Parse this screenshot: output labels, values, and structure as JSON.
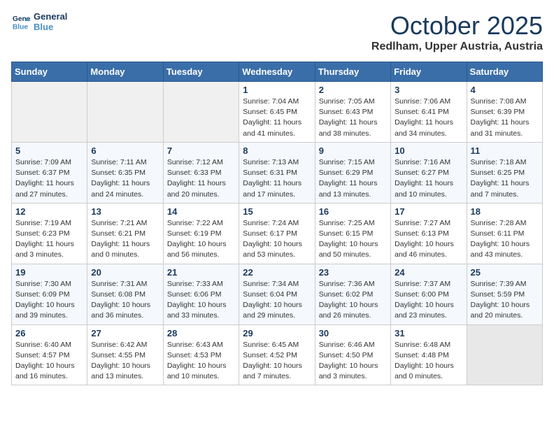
{
  "header": {
    "logo_line1": "General",
    "logo_line2": "Blue",
    "month": "October 2025",
    "location": "Redlham, Upper Austria, Austria"
  },
  "weekdays": [
    "Sunday",
    "Monday",
    "Tuesday",
    "Wednesday",
    "Thursday",
    "Friday",
    "Saturday"
  ],
  "weeks": [
    [
      {
        "day": "",
        "sunrise": "",
        "sunset": "",
        "daylight": ""
      },
      {
        "day": "",
        "sunrise": "",
        "sunset": "",
        "daylight": ""
      },
      {
        "day": "",
        "sunrise": "",
        "sunset": "",
        "daylight": ""
      },
      {
        "day": "1",
        "sunrise": "Sunrise: 7:04 AM",
        "sunset": "Sunset: 6:45 PM",
        "daylight": "Daylight: 11 hours and 41 minutes."
      },
      {
        "day": "2",
        "sunrise": "Sunrise: 7:05 AM",
        "sunset": "Sunset: 6:43 PM",
        "daylight": "Daylight: 11 hours and 38 minutes."
      },
      {
        "day": "3",
        "sunrise": "Sunrise: 7:06 AM",
        "sunset": "Sunset: 6:41 PM",
        "daylight": "Daylight: 11 hours and 34 minutes."
      },
      {
        "day": "4",
        "sunrise": "Sunrise: 7:08 AM",
        "sunset": "Sunset: 6:39 PM",
        "daylight": "Daylight: 11 hours and 31 minutes."
      }
    ],
    [
      {
        "day": "5",
        "sunrise": "Sunrise: 7:09 AM",
        "sunset": "Sunset: 6:37 PM",
        "daylight": "Daylight: 11 hours and 27 minutes."
      },
      {
        "day": "6",
        "sunrise": "Sunrise: 7:11 AM",
        "sunset": "Sunset: 6:35 PM",
        "daylight": "Daylight: 11 hours and 24 minutes."
      },
      {
        "day": "7",
        "sunrise": "Sunrise: 7:12 AM",
        "sunset": "Sunset: 6:33 PM",
        "daylight": "Daylight: 11 hours and 20 minutes."
      },
      {
        "day": "8",
        "sunrise": "Sunrise: 7:13 AM",
        "sunset": "Sunset: 6:31 PM",
        "daylight": "Daylight: 11 hours and 17 minutes."
      },
      {
        "day": "9",
        "sunrise": "Sunrise: 7:15 AM",
        "sunset": "Sunset: 6:29 PM",
        "daylight": "Daylight: 11 hours and 13 minutes."
      },
      {
        "day": "10",
        "sunrise": "Sunrise: 7:16 AM",
        "sunset": "Sunset: 6:27 PM",
        "daylight": "Daylight: 11 hours and 10 minutes."
      },
      {
        "day": "11",
        "sunrise": "Sunrise: 7:18 AM",
        "sunset": "Sunset: 6:25 PM",
        "daylight": "Daylight: 11 hours and 7 minutes."
      }
    ],
    [
      {
        "day": "12",
        "sunrise": "Sunrise: 7:19 AM",
        "sunset": "Sunset: 6:23 PM",
        "daylight": "Daylight: 11 hours and 3 minutes."
      },
      {
        "day": "13",
        "sunrise": "Sunrise: 7:21 AM",
        "sunset": "Sunset: 6:21 PM",
        "daylight": "Daylight: 11 hours and 0 minutes."
      },
      {
        "day": "14",
        "sunrise": "Sunrise: 7:22 AM",
        "sunset": "Sunset: 6:19 PM",
        "daylight": "Daylight: 10 hours and 56 minutes."
      },
      {
        "day": "15",
        "sunrise": "Sunrise: 7:24 AM",
        "sunset": "Sunset: 6:17 PM",
        "daylight": "Daylight: 10 hours and 53 minutes."
      },
      {
        "day": "16",
        "sunrise": "Sunrise: 7:25 AM",
        "sunset": "Sunset: 6:15 PM",
        "daylight": "Daylight: 10 hours and 50 minutes."
      },
      {
        "day": "17",
        "sunrise": "Sunrise: 7:27 AM",
        "sunset": "Sunset: 6:13 PM",
        "daylight": "Daylight: 10 hours and 46 minutes."
      },
      {
        "day": "18",
        "sunrise": "Sunrise: 7:28 AM",
        "sunset": "Sunset: 6:11 PM",
        "daylight": "Daylight: 10 hours and 43 minutes."
      }
    ],
    [
      {
        "day": "19",
        "sunrise": "Sunrise: 7:30 AM",
        "sunset": "Sunset: 6:09 PM",
        "daylight": "Daylight: 10 hours and 39 minutes."
      },
      {
        "day": "20",
        "sunrise": "Sunrise: 7:31 AM",
        "sunset": "Sunset: 6:08 PM",
        "daylight": "Daylight: 10 hours and 36 minutes."
      },
      {
        "day": "21",
        "sunrise": "Sunrise: 7:33 AM",
        "sunset": "Sunset: 6:06 PM",
        "daylight": "Daylight: 10 hours and 33 minutes."
      },
      {
        "day": "22",
        "sunrise": "Sunrise: 7:34 AM",
        "sunset": "Sunset: 6:04 PM",
        "daylight": "Daylight: 10 hours and 29 minutes."
      },
      {
        "day": "23",
        "sunrise": "Sunrise: 7:36 AM",
        "sunset": "Sunset: 6:02 PM",
        "daylight": "Daylight: 10 hours and 26 minutes."
      },
      {
        "day": "24",
        "sunrise": "Sunrise: 7:37 AM",
        "sunset": "Sunset: 6:00 PM",
        "daylight": "Daylight: 10 hours and 23 minutes."
      },
      {
        "day": "25",
        "sunrise": "Sunrise: 7:39 AM",
        "sunset": "Sunset: 5:59 PM",
        "daylight": "Daylight: 10 hours and 20 minutes."
      }
    ],
    [
      {
        "day": "26",
        "sunrise": "Sunrise: 6:40 AM",
        "sunset": "Sunset: 4:57 PM",
        "daylight": "Daylight: 10 hours and 16 minutes."
      },
      {
        "day": "27",
        "sunrise": "Sunrise: 6:42 AM",
        "sunset": "Sunset: 4:55 PM",
        "daylight": "Daylight: 10 hours and 13 minutes."
      },
      {
        "day": "28",
        "sunrise": "Sunrise: 6:43 AM",
        "sunset": "Sunset: 4:53 PM",
        "daylight": "Daylight: 10 hours and 10 minutes."
      },
      {
        "day": "29",
        "sunrise": "Sunrise: 6:45 AM",
        "sunset": "Sunset: 4:52 PM",
        "daylight": "Daylight: 10 hours and 7 minutes."
      },
      {
        "day": "30",
        "sunrise": "Sunrise: 6:46 AM",
        "sunset": "Sunset: 4:50 PM",
        "daylight": "Daylight: 10 hours and 3 minutes."
      },
      {
        "day": "31",
        "sunrise": "Sunrise: 6:48 AM",
        "sunset": "Sunset: 4:48 PM",
        "daylight": "Daylight: 10 hours and 0 minutes."
      },
      {
        "day": "",
        "sunrise": "",
        "sunset": "",
        "daylight": ""
      }
    ]
  ]
}
